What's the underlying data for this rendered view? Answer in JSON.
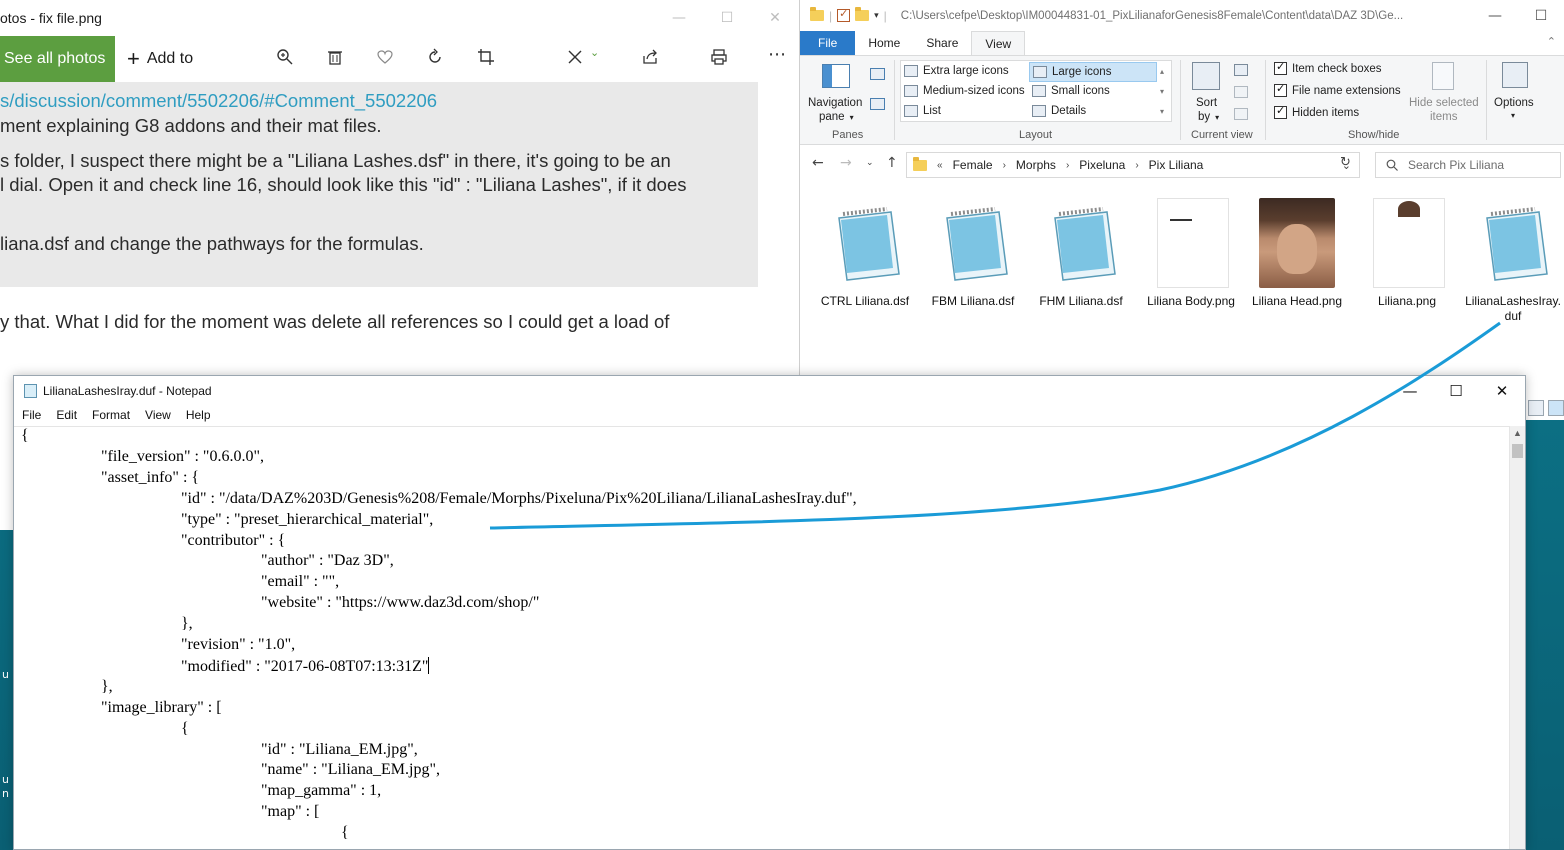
{
  "photos": {
    "title": "otos - fix file.png",
    "see_all": "See all photos",
    "add_to": "Add to",
    "link": "s/discussion/comment/5502206/#Comment_5502206",
    "quote_lines": [
      "ment explaining G8 addons and their mat files.",
      "s folder, I suspect there might be a \"Liliana Lashes.dsf\" in there, it's going to be an",
      "l dial. Open it and check line 16, should look like this \"id\" : \"Liliana Lashes\", if it does",
      "liana.dsf and change the pathways for the formulas."
    ],
    "body_lines": [
      "y that. What I did for the moment was delete all references so I could get a load of"
    ]
  },
  "explorer": {
    "path": "C:\\Users\\cefpe\\Desktop\\IM00044831-01_PixLilianaforGenesis8Female\\Content\\data\\DAZ 3D\\Ge...",
    "tabs": [
      "File",
      "Home",
      "Share",
      "View"
    ],
    "ribbon": {
      "navigation_pane": "Navigation",
      "navigation_pane_2": "pane",
      "panes_label": "Panes",
      "layout_items": [
        "Extra large icons",
        "Large icons",
        "Medium-sized icons",
        "Small icons",
        "List",
        "Details"
      ],
      "layout_label": "Layout",
      "sort_by": "Sort",
      "sort_by_2": "by",
      "current_view_label": "Current view",
      "checkboxes": [
        "Item check boxes",
        "File name extensions",
        "Hidden items"
      ],
      "hide_selected": "Hide selected",
      "hide_selected_2": "items",
      "show_hide_label": "Show/hide",
      "options": "Options"
    },
    "breadcrumb": [
      "Female",
      "Morphs",
      "Pixeluna",
      "Pix Liliana"
    ],
    "search_placeholder": "Search Pix Liliana",
    "files": [
      {
        "name": "CTRL Liliana.dsf",
        "kind": "notepad"
      },
      {
        "name": "FBM Liliana.dsf",
        "kind": "notepad"
      },
      {
        "name": "FHM Liliana.dsf",
        "kind": "notepad"
      },
      {
        "name": "Liliana Body.png",
        "kind": "white"
      },
      {
        "name": "Liliana Head.png",
        "kind": "face"
      },
      {
        "name": "Liliana.png",
        "kind": "white"
      },
      {
        "name": "LilianaLashesIray.",
        "name2": "duf",
        "kind": "notepad"
      }
    ]
  },
  "notepad": {
    "title": "LilianaLashesIray.duf - Notepad",
    "menu": [
      "File",
      "Edit",
      "Format",
      "View",
      "Help"
    ],
    "lines": [
      {
        "indent": 0,
        "text": "{"
      },
      {
        "indent": 1,
        "text": "\"file_version\" : \"0.6.0.0\","
      },
      {
        "indent": 1,
        "text": "\"asset_info\" : {"
      },
      {
        "indent": 2,
        "text": "\"id\" : \"/data/DAZ%203D/Genesis%208/Female/Morphs/Pixeluna/Pix%20Liliana/LilianaLashesIray.duf\","
      },
      {
        "indent": 2,
        "text": "\"type\" : \"preset_hierarchical_material\","
      },
      {
        "indent": 2,
        "text": "\"contributor\" : {"
      },
      {
        "indent": 3,
        "text": "\"author\" : \"Daz 3D\","
      },
      {
        "indent": 3,
        "text": "\"email\" : \"\","
      },
      {
        "indent": 3,
        "text": "\"website\" : \"https://www.daz3d.com/shop/\""
      },
      {
        "indent": 2,
        "text": "},"
      },
      {
        "indent": 2,
        "text": "\"revision\" : \"1.0\","
      },
      {
        "indent": 2,
        "text": "\"modified\" : \"2017-06-08T07:13:31Z\""
      },
      {
        "indent": 1,
        "text": "},"
      },
      {
        "indent": 1,
        "text": "\"image_library\" : ["
      },
      {
        "indent": 2,
        "text": "{"
      },
      {
        "indent": 3,
        "text": "\"id\" : \"Liliana_EM.jpg\","
      },
      {
        "indent": 3,
        "text": "\"name\" : \"Liliana_EM.jpg\","
      },
      {
        "indent": 3,
        "text": "\"map_gamma\" : 1,"
      },
      {
        "indent": 3,
        "text": "\"map\" : ["
      },
      {
        "indent": 4,
        "text": "{"
      }
    ]
  },
  "desktop": {
    "fragments": [
      "u",
      "u",
      "n"
    ]
  },
  "colors": {
    "photos_accent": "#5c9e40",
    "link": "#2f9dc1",
    "explorer_file_tab": "#2a7ac9",
    "annotation": "#1a9bd7"
  }
}
